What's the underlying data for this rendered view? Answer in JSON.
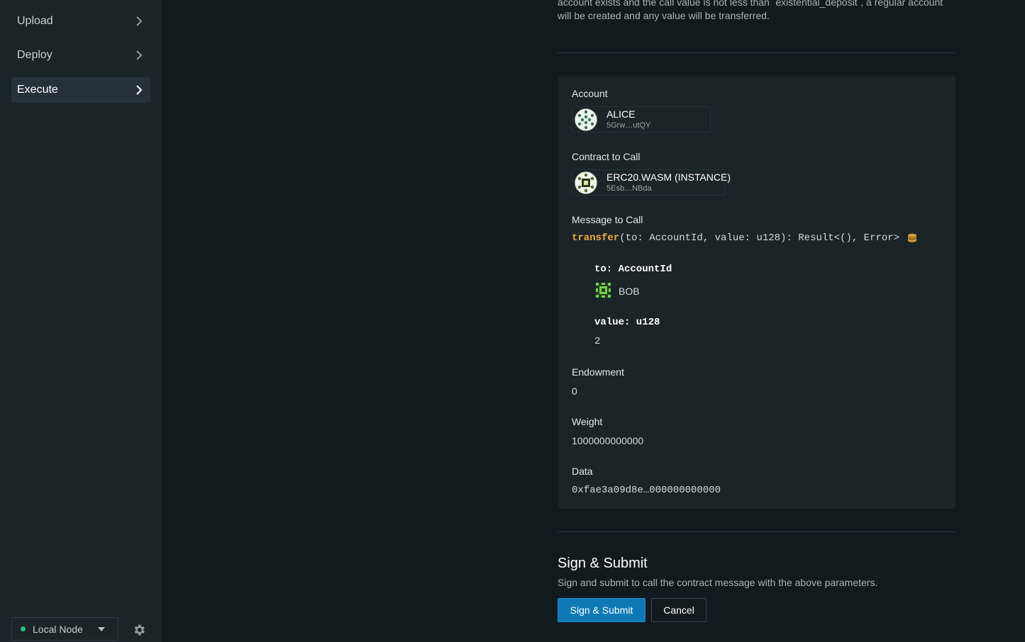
{
  "sidebar": {
    "items": [
      {
        "label": "Upload"
      },
      {
        "label": "Deploy"
      },
      {
        "label": "Execute",
        "active": true
      }
    ],
    "node": {
      "label": "Local Node",
      "status_color": "#22c07a"
    },
    "settings_icon": "gear-icon"
  },
  "intro_text": "account exists and the call value is not less than `existential_deposit`, a regular account will be created and any value will be transferred.",
  "form": {
    "account": {
      "label": "Account",
      "name": "ALICE",
      "address": "5Grw…utQY"
    },
    "contract": {
      "label": "Contract to Call",
      "name": "ERC20.WASM (INSTANCE)",
      "address": "5Esb…NBda"
    },
    "message": {
      "label": "Message to Call",
      "fn_name": "transfer",
      "signature": "(to: AccountId, value: u128): Result<(), Error>",
      "payable_icon": "coins-icon",
      "params": [
        {
          "label": "to: AccountId",
          "value": "BOB"
        },
        {
          "label": "value: u128",
          "value": "2"
        }
      ]
    },
    "endowment": {
      "label": "Endowment",
      "value": "0"
    },
    "weight": {
      "label": "Weight",
      "value": "1000000000000"
    },
    "data": {
      "label": "Data",
      "value": "0xfae3a09d8e…000000000000"
    }
  },
  "submit": {
    "title": "Sign & Submit",
    "description": "Sign and submit to call the contract message with the above parameters.",
    "primary_label": "Sign & Submit",
    "cancel_label": "Cancel"
  },
  "colors": {
    "accent": "#0f79b6",
    "function_name": "#f2a93b",
    "status_ok": "#22c07a"
  }
}
